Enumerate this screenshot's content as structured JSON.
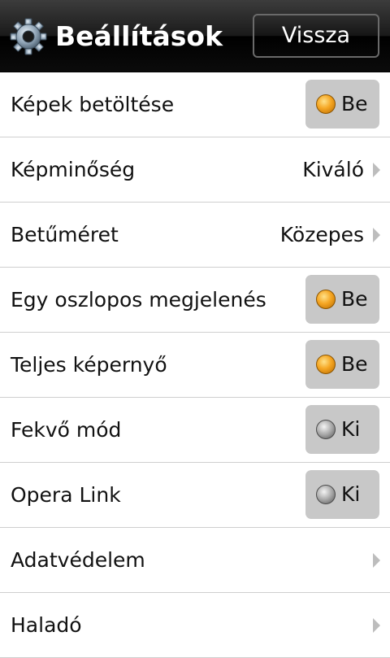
{
  "header": {
    "title": "Beállítások",
    "back_label": "Vissza",
    "icon": "gear-icon"
  },
  "settings": [
    {
      "label": "Képek betöltése",
      "type": "toggle",
      "state": "on",
      "value": "Be"
    },
    {
      "label": "Képminőség",
      "type": "select",
      "value": "Kiváló"
    },
    {
      "label": "Betűméret",
      "type": "select",
      "value": "Közepes"
    },
    {
      "label": "Egy oszlopos megjelenés",
      "type": "toggle",
      "state": "on",
      "value": "Be"
    },
    {
      "label": "Teljes képernyő",
      "type": "toggle",
      "state": "on",
      "value": "Be"
    },
    {
      "label": "Fekvő mód",
      "type": "toggle",
      "state": "off",
      "value": "Ki"
    },
    {
      "label": "Opera Link",
      "type": "toggle",
      "state": "off",
      "value": "Ki"
    },
    {
      "label": "Adatvédelem",
      "type": "link",
      "value": ""
    },
    {
      "label": "Haladó",
      "type": "link",
      "value": ""
    }
  ],
  "colors": {
    "toggle_on": "#f5a623",
    "toggle_off": "#a8a8a8",
    "toggle_bg": "#c8c8c8",
    "chevron": "#bdbdbd"
  }
}
